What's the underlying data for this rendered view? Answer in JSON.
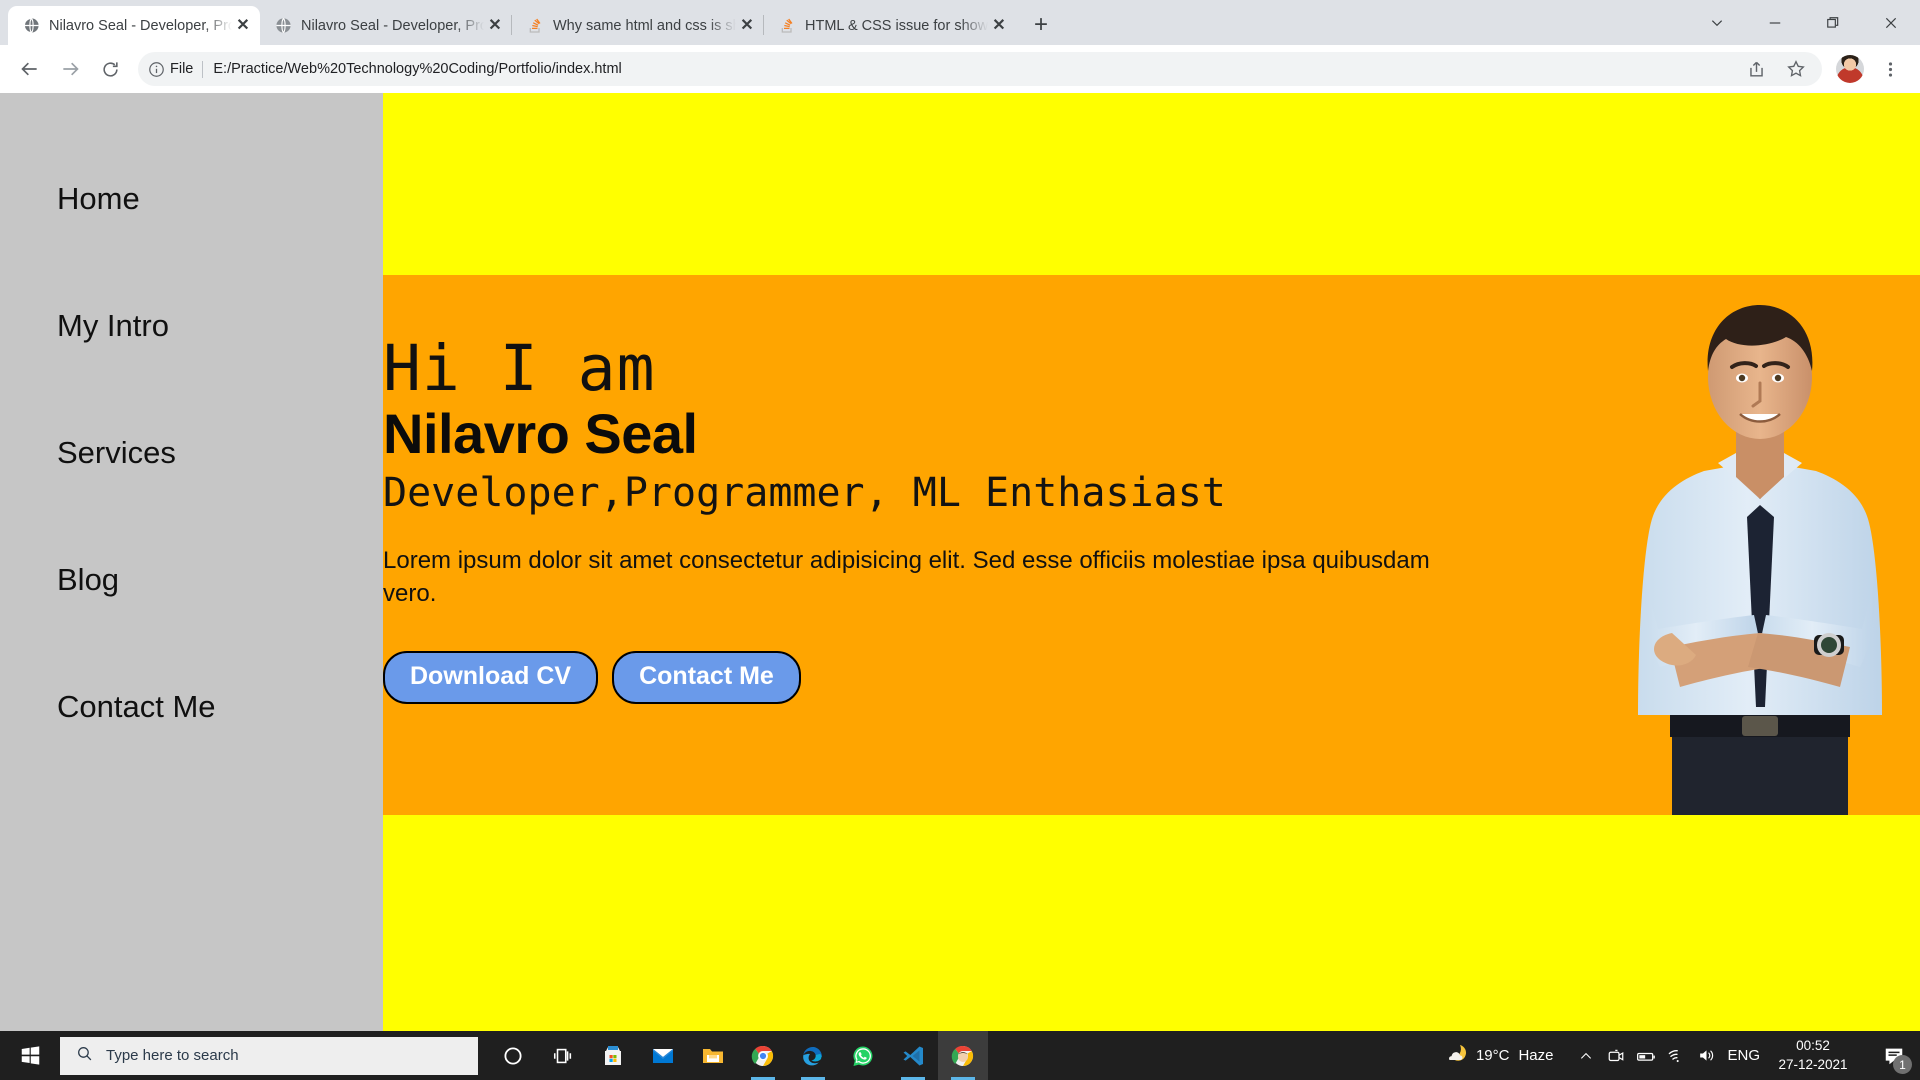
{
  "browser": {
    "tabs": [
      {
        "title": "Nilavro Seal - Developer, Programmer, ML Enthasiast",
        "favicon": "globe-icon",
        "active": true
      },
      {
        "title": "Nilavro Seal - Developer, Programmer, ML Enthasiast",
        "favicon": "globe-icon",
        "active": false
      },
      {
        "title": "Why same html and css is showing different result",
        "favicon": "stackoverflow-icon",
        "active": false
      },
      {
        "title": "HTML & CSS issue for showing UI",
        "favicon": "stackoverflow-icon",
        "active": false
      }
    ],
    "new_tab_label": "+",
    "close_label": "✕",
    "window_controls": {
      "tab_search": "∨",
      "minimize": "—",
      "restore": "❐",
      "close": "✕"
    },
    "toolbar": {
      "back": "back-arrow-icon",
      "forward": "forward-arrow-icon",
      "reload": "reload-icon",
      "scheme_label": "File",
      "url": "E:/Practice/Web%20Technology%20Coding/Portfolio/index.html",
      "share": "share-icon",
      "bookmark": "star-icon",
      "profile": "avatar",
      "menu": "three-dot-menu-icon"
    }
  },
  "page": {
    "colors": {
      "sidebar": "#c6c6c6",
      "page_background": "#ffff00",
      "hero_background": "#ffa500",
      "button": "#6a9aea",
      "button_text": "#ffffff"
    },
    "sidebar": {
      "items": [
        {
          "label": "Home"
        },
        {
          "label": "My Intro"
        },
        {
          "label": "Services"
        },
        {
          "label": "Blog"
        },
        {
          "label": "Contact Me"
        }
      ]
    },
    "hero": {
      "greeting": "Hi I am",
      "name": "Nilavro Seal",
      "role": "Developer,Programmer, ML Enthasiast",
      "blurb": "Lorem ipsum dolor sit amet consectetur adipisicing elit. Sed esse officiis molestiae ipsa quibusdam vero.",
      "buttons": [
        {
          "label": "Download CV"
        },
        {
          "label": "Contact Me"
        }
      ],
      "photo_alt": "portrait-photo-man-blue-shirt-arms-crossed"
    }
  },
  "taskbar": {
    "start": "windows-start-icon",
    "search_placeholder": "Type here to search",
    "apps": [
      {
        "name": "cortana-icon"
      },
      {
        "name": "task-view-icon"
      },
      {
        "name": "microsoft-store-icon"
      },
      {
        "name": "mail-icon"
      },
      {
        "name": "file-explorer-icon"
      },
      {
        "name": "chrome-icon"
      },
      {
        "name": "edge-icon"
      },
      {
        "name": "whatsapp-icon"
      },
      {
        "name": "vscode-icon"
      },
      {
        "name": "chrome-active-icon"
      }
    ],
    "tray": {
      "weather_temp": "19°C",
      "weather_desc": "Haze",
      "overflow": "∧",
      "language": "ENG",
      "time": "00:52",
      "date": "27-12-2021",
      "notification_count": "1"
    }
  }
}
